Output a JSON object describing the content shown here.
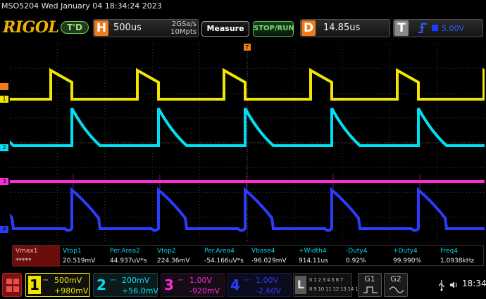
{
  "header": {
    "status_line": "MSO5204  Wed January 04 18:34:24 2023"
  },
  "toolbar": {
    "logo": "RIGOL",
    "trigger_status": "T'D",
    "horizontal": {
      "letter": "H",
      "timebase": "500us",
      "sample_rate": "2GSa/s",
      "memory_depth": "10Mpts"
    },
    "measure_label": "Measure",
    "stop_run_label": "STOP/RUN",
    "delay": {
      "letter": "D",
      "value": "14.85us"
    },
    "trigger": {
      "letter": "T",
      "edge_icon": "rising-edge-icon",
      "level": "5.00V",
      "source_color": "#1a3cff"
    }
  },
  "measurements": [
    {
      "name": "Vmax1",
      "value": "*****"
    },
    {
      "name": "Vtop1",
      "value": "20.519mV"
    },
    {
      "name": "Per.Area2",
      "value": "44.937uV*s"
    },
    {
      "name": "Vtop2",
      "value": "224.36mV"
    },
    {
      "name": "Per.Area4",
      "value": "-54.166uV*s"
    },
    {
      "name": "Vbase4",
      "value": "-96.029mV"
    },
    {
      "name": "+Width4",
      "value": "914.11us"
    },
    {
      "name": "-Duty4",
      "value": "0.92%"
    },
    {
      "name": "+Duty4",
      "value": "99.990%"
    },
    {
      "name": "Freq4",
      "value": "1.0938kHz"
    }
  ],
  "channels": [
    {
      "num": "1",
      "scale": "500mV",
      "offset": "+980mV",
      "coupling": "DC",
      "color": "#f2e600"
    },
    {
      "num": "2",
      "scale": "200mV",
      "offset": "+56.0mV",
      "coupling": "DC",
      "color": "#00e0f0"
    },
    {
      "num": "3",
      "scale": "1.00V",
      "offset": "-920mV",
      "coupling": "DC",
      "color": "#ff2bd6"
    },
    {
      "num": "4",
      "scale": "1.00V",
      "offset": "-2.60V",
      "coupling": "DC",
      "color": "#2b3cff"
    }
  ],
  "la": {
    "letter": "L",
    "row1": "0 1 2 3 4 5 6 7",
    "row2": "8 9 10 11 12 13 14 15"
  },
  "generators": [
    {
      "label": "G1"
    },
    {
      "label": "G2"
    }
  ],
  "system": {
    "time": "18:34"
  },
  "waveform_markers": {
    "trigger_marker": "T",
    "ch1_marker": "1",
    "ch2_marker": "2",
    "ch3_marker": "3",
    "ch4_marker": "4"
  }
}
